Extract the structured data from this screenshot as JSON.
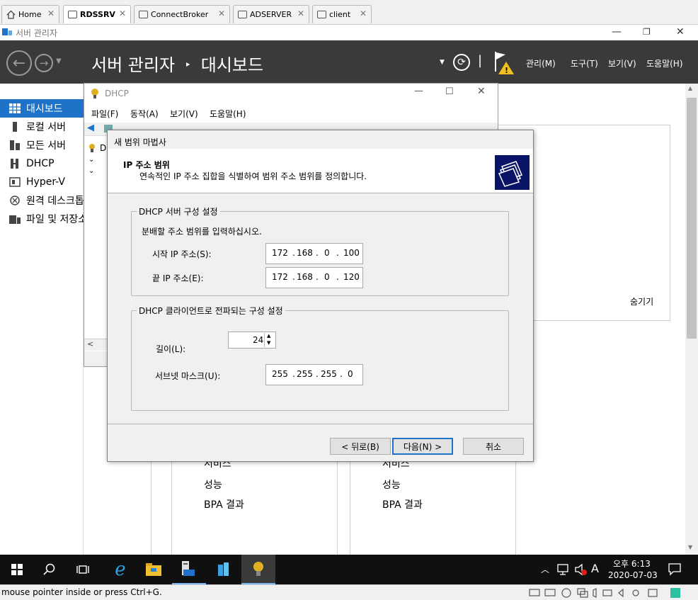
{
  "vm_tabs": [
    {
      "label": "Home",
      "icon": "home-icon"
    },
    {
      "label": "RDSSRV",
      "icon": "vm-icon",
      "active": true
    },
    {
      "label": "ConnectBroker",
      "icon": "vm-icon"
    },
    {
      "label": "ADSERVER",
      "icon": "vm-icon"
    },
    {
      "label": "client",
      "icon": "vm-icon"
    }
  ],
  "server_manager": {
    "window_title": "서버 관리자",
    "breadcrumb": "서버 관리자",
    "breadcrumb_sep": "‣",
    "breadcrumb_page": "대시보드",
    "menus": [
      "관리(M)",
      "도구(T)",
      "보기(V)",
      "도움말(H)"
    ]
  },
  "nav": [
    {
      "label": "대시보드",
      "icon": "dashboard-icon",
      "selected": true
    },
    {
      "label": "로컬 서버",
      "icon": "local-server-icon"
    },
    {
      "label": "모든 서버",
      "icon": "all-servers-icon"
    },
    {
      "label": "DHCP",
      "icon": "dhcp-icon"
    },
    {
      "label": "Hyper-V",
      "icon": "hyperv-icon"
    },
    {
      "label": "원격 데스크톱 서비스",
      "icon": "remote-desktop-icon"
    },
    {
      "label": "파일 및 저장소 서비스",
      "icon": "file-storage-icon"
    }
  ],
  "dashboard": {
    "hide_label": "숨기기",
    "tiles": [
      {
        "items": [
          "서비스",
          "성능",
          "BPA 결과"
        ]
      },
      {
        "items": [
          "서비스",
          "성능",
          "BPA 결과"
        ]
      }
    ]
  },
  "dhcp_window": {
    "title": "DHCP",
    "menu": [
      "파일(F)",
      "동작(A)",
      "보기(V)",
      "도움말(H)"
    ],
    "tree_label": "D"
  },
  "wizard": {
    "title": "새 범위 마법사",
    "heading": "IP 주소 범위",
    "subheading": "연속적인 IP 주소 집합을 식별하여 범위 주소 범위를 정의합니다.",
    "server_group": {
      "label": "DHCP 서버 구성 설정",
      "instruction": "분배할 주소 범위를 입력하십시오.",
      "start_label": "시작 IP 주소(S):",
      "start_ip": [
        "172",
        "168",
        "0",
        "100"
      ],
      "end_label": "끝 IP 주소(E):",
      "end_ip": [
        "172",
        "168",
        "0",
        "120"
      ]
    },
    "client_group": {
      "label": "DHCP 클라이언트로 전파되는 구성 설정",
      "length_label": "길이(L):",
      "length_value": "24",
      "mask_label": "서브넷 마스크(U):",
      "mask": [
        "255",
        "255",
        "255",
        "0"
      ]
    },
    "buttons": {
      "back": "< 뒤로(B)",
      "next": "다음(N) >",
      "cancel": "취소"
    }
  },
  "taskbar": {
    "time": "오후 6:13",
    "date": "2020-07-03",
    "ime": "A"
  },
  "status_bar": {
    "text": "mouse pointer inside or press Ctrl+G."
  }
}
